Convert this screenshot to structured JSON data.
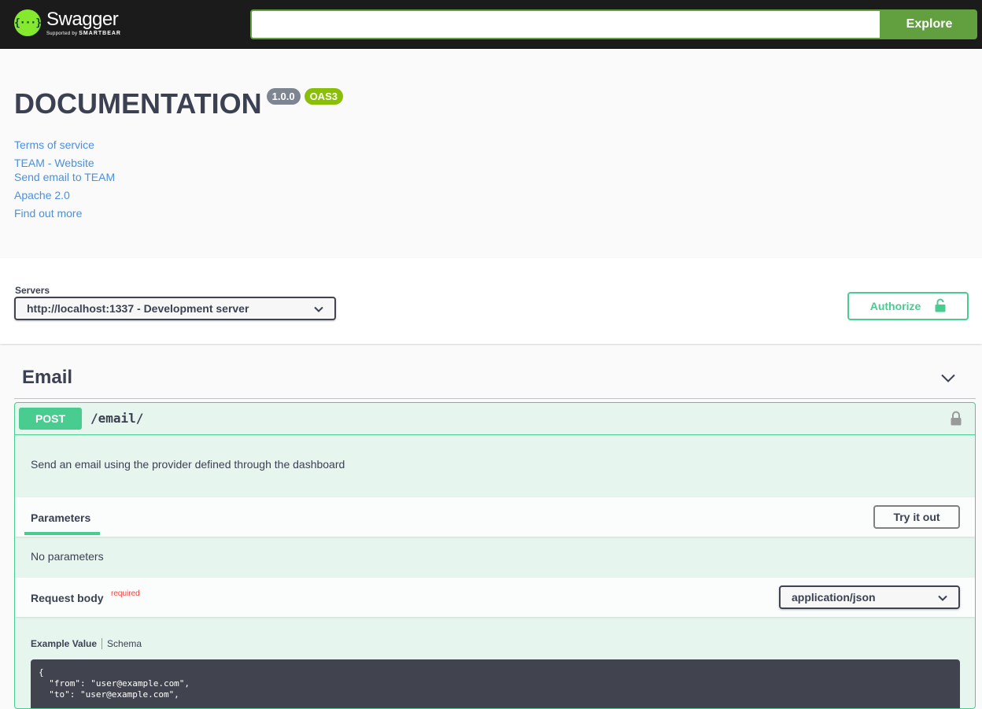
{
  "topbar": {
    "logo_name": "Swagger",
    "logo_sub_prefix": "Supported by",
    "logo_sub_brand": "SMARTBEAR",
    "logo_mark": "{···}",
    "search_value": "",
    "explore_label": "Explore"
  },
  "info": {
    "title": "DOCUMENTATION",
    "version": "1.0.0",
    "oas": "OAS3",
    "links": {
      "terms": "Terms of service",
      "website": "TEAM - Website",
      "email": "Send email to TEAM",
      "license": "Apache 2.0",
      "more": "Find out more"
    }
  },
  "servers": {
    "label": "Servers",
    "selected": "http://localhost:1337 - Development server",
    "authorize_label": "Authorize"
  },
  "tag": {
    "name": "Email"
  },
  "operation": {
    "method": "POST",
    "path": "/email/",
    "description": "Send an email using the provider defined through the dashboard",
    "parameters_tab": "Parameters",
    "try_label": "Try it out",
    "no_params": "No parameters",
    "request_body_label": "Request body",
    "required_label": "required",
    "content_type": "application/json",
    "example_tab": "Example Value",
    "schema_tab": "Schema",
    "example_code": "{\n  \"from\": \"user@example.com\",\n  \"to\": \"user@example.com\","
  },
  "colors": {
    "topbar_bg": "#1b1b1b",
    "explore_green": "#62a03f",
    "post_green": "#49cc90",
    "link_blue": "#4990e2",
    "version_badge": "#7d8492",
    "oas_badge": "#89bf04",
    "required_red": "#f93e3e"
  },
  "icons": {
    "server_select": "chevron-down-icon",
    "authorize": "lock-open-icon",
    "tag_toggle": "chevron-down-icon",
    "operation_lock": "lock-icon",
    "content_type_select": "chevron-down-icon"
  }
}
